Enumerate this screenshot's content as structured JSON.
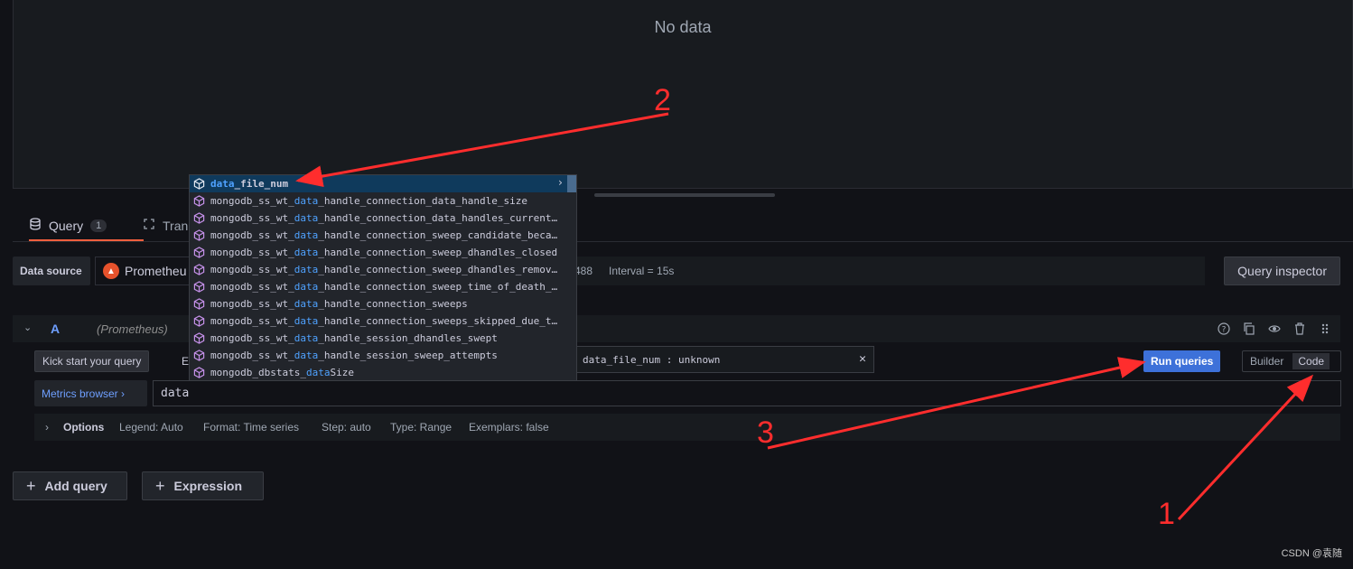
{
  "panel": {
    "empty_text": "No data"
  },
  "tabs": [
    {
      "label": "Query",
      "count": "1",
      "icon": "database-icon"
    },
    {
      "label": "Transform",
      "visible_text": "Tran",
      "icon": "transform-icon"
    }
  ],
  "datasource": {
    "label": "Data source",
    "selected": "Prometheus",
    "selected_visible": "Prometheu",
    "max_points": "488",
    "interval": "Interval = 15s",
    "query_inspector": "Query inspector"
  },
  "query": {
    "ref": "A",
    "datasource": "(Prometheus)",
    "kick_start": "Kick start your query",
    "explain_visible": "E",
    "run": "Run queries",
    "mode_builder": "Builder",
    "mode_code": "Code",
    "metrics_browser": "Metrics browser ›",
    "expression": "data",
    "hover_info": "data_file_num : unknown",
    "options": {
      "title": "Options",
      "legend": "Legend: Auto",
      "format": "Format: Time series",
      "step": "Step: auto",
      "type": "Type: Range",
      "exemplars": "Exemplars: false"
    }
  },
  "suggestions": [
    {
      "pre": "",
      "hl": "data",
      "post": "_file_num",
      "selected": true
    },
    {
      "pre": "mongodb_ss_wt_",
      "hl": "data",
      "post": "_handle_connection_data_handle_size"
    },
    {
      "pre": "mongodb_ss_wt_",
      "hl": "data",
      "post": "_handle_connection_data_handles_current…"
    },
    {
      "pre": "mongodb_ss_wt_",
      "hl": "data",
      "post": "_handle_connection_sweep_candidate_beca…"
    },
    {
      "pre": "mongodb_ss_wt_",
      "hl": "data",
      "post": "_handle_connection_sweep_dhandles_closed"
    },
    {
      "pre": "mongodb_ss_wt_",
      "hl": "data",
      "post": "_handle_connection_sweep_dhandles_remov…"
    },
    {
      "pre": "mongodb_ss_wt_",
      "hl": "data",
      "post": "_handle_connection_sweep_time_of_death_…"
    },
    {
      "pre": "mongodb_ss_wt_",
      "hl": "data",
      "post": "_handle_connection_sweeps"
    },
    {
      "pre": "mongodb_ss_wt_",
      "hl": "data",
      "post": "_handle_connection_sweeps_skipped_due_t…"
    },
    {
      "pre": "mongodb_ss_wt_",
      "hl": "data",
      "post": "_handle_session_dhandles_swept"
    },
    {
      "pre": "mongodb_ss_wt_",
      "hl": "data",
      "post": "_handle_session_sweep_attempts"
    },
    {
      "pre": "mongodb_dbstats_",
      "hl": "data",
      "post": "Size"
    }
  ],
  "buttons": {
    "add_query": "Add query",
    "expression": "Expression"
  },
  "annotations": {
    "one": "1",
    "two": "2",
    "three": "3"
  },
  "watermark": "CSDN @袁随",
  "colors": {
    "accent_orange": "#f55f3e",
    "run_blue": "#3d71d9",
    "link_blue": "#6e9fff",
    "annotation_red": "#ff2d2d"
  }
}
